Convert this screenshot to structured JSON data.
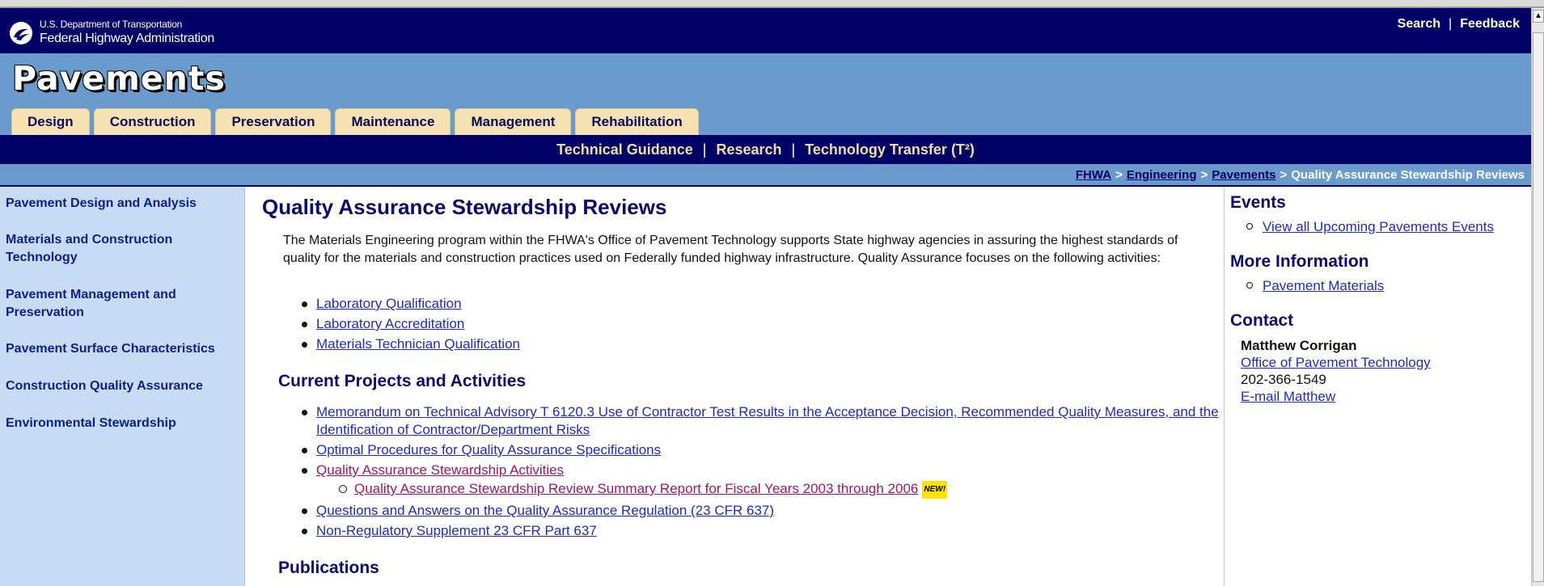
{
  "header": {
    "agency_small": "U.S. Department of Transportation",
    "agency_big": "Federal Highway Administration",
    "util_links": [
      "Search",
      "Feedback"
    ],
    "site_title": "Pavements"
  },
  "tabs": [
    "Design",
    "Construction",
    "Preservation",
    "Maintenance",
    "Management",
    "Rehabilitation"
  ],
  "subnav": [
    "Technical Guidance",
    "Research",
    "Technology Transfer (T²)"
  ],
  "breadcrumb": {
    "links": [
      "FHWA",
      "Engineering",
      "Pavements"
    ],
    "current": "Quality Assurance Stewardship Reviews",
    "separator": ">"
  },
  "leftnav": [
    "Pavement Design and Analysis",
    "Materials and Construction Technology",
    "Pavement Management and Preservation",
    "Pavement Surface Characteristics",
    "Construction Quality Assurance",
    "Environmental Stewardship"
  ],
  "main": {
    "title": "Quality Assurance Stewardship Reviews",
    "intro": "The Materials Engineering program within the FHWA's Office of Pavement Technology supports State highway agencies in assuring the highest standards of quality for the materials and construction practices used on Federally funded highway infrastructure. Quality Assurance focuses on the following activities:",
    "activities": [
      "Laboratory Qualification",
      "Laboratory Accreditation",
      "Materials Technician Qualification"
    ],
    "projects_heading": "Current Projects and Activities",
    "projects": [
      "Memorandum on Technical Advisory T 6120.3 Use of Contractor Test Results in the Acceptance Decision, Recommended Quality Measures, and the Identification of Contractor/Department Risks",
      "Optimal Procedures for Quality Assurance Specifications",
      "Quality Assurance Stewardship Activities",
      "Questions and Answers on the Quality Assurance Regulation (23 CFR 637)",
      "Non-Regulatory Supplement 23 CFR Part 637"
    ],
    "sub_project": "Quality Assurance Stewardship Review Summary Report for Fiscal Years 2003 through 2006",
    "new_badge": "NEW!",
    "publications_heading": "Publications"
  },
  "rightcol": {
    "events_heading": "Events",
    "events_link": "View all Upcoming Pavements Events",
    "more_heading": "More Information",
    "more_link": "Pavement Materials",
    "contact_heading": "Contact",
    "contact_name": "Matthew Corrigan",
    "contact_office": "Office of Pavement Technology",
    "contact_phone": "202-366-1549",
    "contact_email": "E-mail Matthew"
  },
  "colors": {
    "header_navy": "#000066",
    "banner_blue": "#6b9bcd",
    "tab_tan": "#f6e1b3",
    "leftnav_bg": "#c7dbf5",
    "link_blue": "#1f2bbf",
    "visited_link": "#a0156a"
  },
  "icons": {
    "logo": "fhwa-logo-icon",
    "scroll_up": "chevron-up-icon"
  }
}
